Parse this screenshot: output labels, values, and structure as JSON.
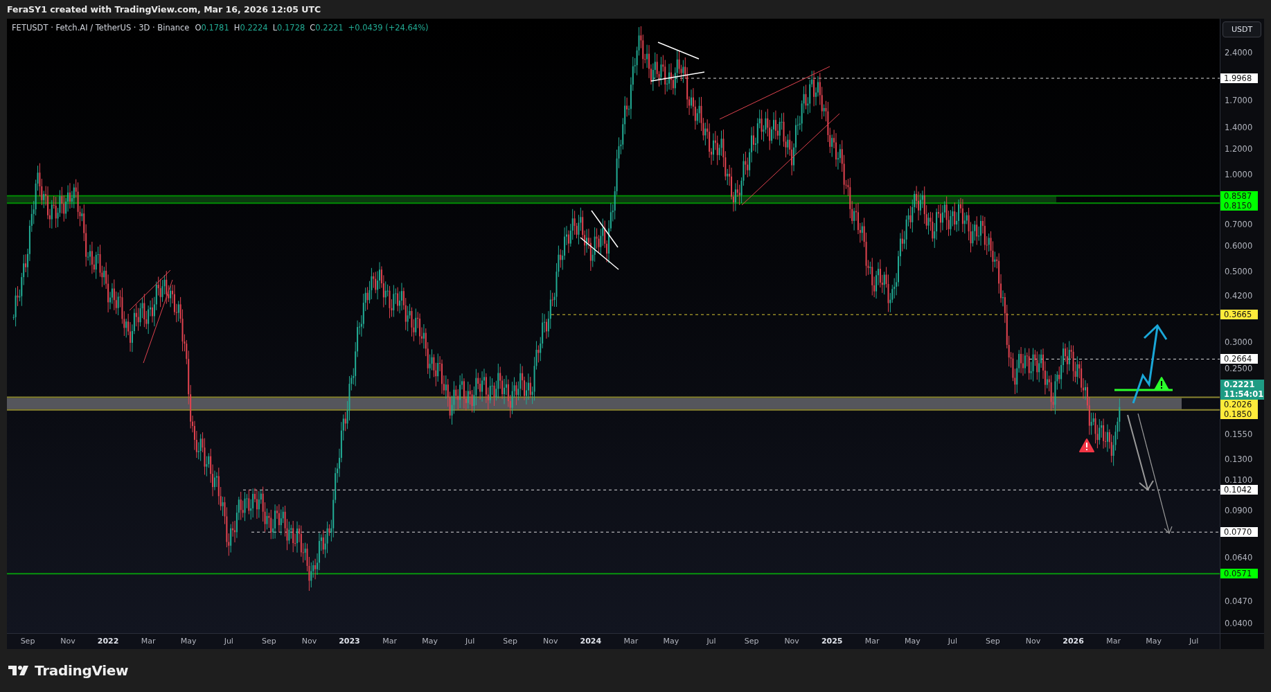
{
  "attribution": "FeraSY1 created with TradingView.com, Mar 16, 2026 12:05 UTC",
  "legend": {
    "symbol": "FETUSDT · Fetch.AI / TetherUS · 3D · Binance",
    "ohlc": [
      {
        "key": "O",
        "value": "0.1781"
      },
      {
        "key": "H",
        "value": "0.2224"
      },
      {
        "key": "L",
        "value": "0.1728"
      },
      {
        "key": "C",
        "value": "0.2221"
      }
    ],
    "change": "+0.0439 (+24.64%)"
  },
  "price_axis": {
    "currency": "USDT",
    "ticks": [
      "2.4000",
      "1.7000",
      "1.4000",
      "1.2000",
      "1.0000",
      "0.7000",
      "0.6000",
      "0.5000",
      "0.4200",
      "0.3000",
      "0.2500",
      "0.1550",
      "0.1300",
      "0.1100",
      "0.0900",
      "0.0640",
      "0.0470",
      "0.0400"
    ],
    "levels": [
      {
        "text": "1.9968",
        "color": "#ffffff",
        "kind": "dashed"
      },
      {
        "text": "0.8587",
        "color": "#00ff00",
        "kind": "solid"
      },
      {
        "text": "0.8150",
        "color": "#00ff00",
        "kind": "solid"
      },
      {
        "text": "0.3665",
        "color": "#ffeb3b",
        "kind": "dashed"
      },
      {
        "text": "0.2664",
        "color": "#ffffff",
        "kind": "dashed"
      },
      {
        "text": "0.2026",
        "color": "#ffeb3b",
        "kind": "band"
      },
      {
        "text": "0.1850",
        "color": "#ffeb3b",
        "kind": "band"
      },
      {
        "text": "0.1042",
        "color": "#ffffff",
        "kind": "dashed"
      },
      {
        "text": "0.0770",
        "color": "#ffffff",
        "kind": "dashed"
      },
      {
        "text": "0.0571",
        "color": "#00ff00",
        "kind": "solid"
      }
    ],
    "current": {
      "price": "0.2221",
      "countdown": "11:54:01"
    }
  },
  "time_axis": [
    {
      "label": "Sep",
      "kind": "month"
    },
    {
      "label": "Nov",
      "kind": "month"
    },
    {
      "label": "2022",
      "kind": "year"
    },
    {
      "label": "Mar",
      "kind": "month"
    },
    {
      "label": "May",
      "kind": "month"
    },
    {
      "label": "Jul",
      "kind": "month"
    },
    {
      "label": "Sep",
      "kind": "month"
    },
    {
      "label": "Nov",
      "kind": "month"
    },
    {
      "label": "2023",
      "kind": "year"
    },
    {
      "label": "Mar",
      "kind": "month"
    },
    {
      "label": "May",
      "kind": "month"
    },
    {
      "label": "Jul",
      "kind": "month"
    },
    {
      "label": "Sep",
      "kind": "month"
    },
    {
      "label": "Nov",
      "kind": "month"
    },
    {
      "label": "2024",
      "kind": "year"
    },
    {
      "label": "Mar",
      "kind": "month"
    },
    {
      "label": "May",
      "kind": "month"
    },
    {
      "label": "Jul",
      "kind": "month"
    },
    {
      "label": "Sep",
      "kind": "month"
    },
    {
      "label": "Nov",
      "kind": "month"
    },
    {
      "label": "2025",
      "kind": "year"
    },
    {
      "label": "Mar",
      "kind": "month"
    },
    {
      "label": "May",
      "kind": "month"
    },
    {
      "label": "Jul",
      "kind": "month"
    },
    {
      "label": "Sep",
      "kind": "month"
    },
    {
      "label": "Nov",
      "kind": "month"
    },
    {
      "label": "2026",
      "kind": "year"
    },
    {
      "label": "Mar",
      "kind": "month"
    },
    {
      "label": "May",
      "kind": "month"
    },
    {
      "label": "Jul",
      "kind": "month"
    }
  ],
  "footer": {
    "brand": "TradingView"
  }
}
